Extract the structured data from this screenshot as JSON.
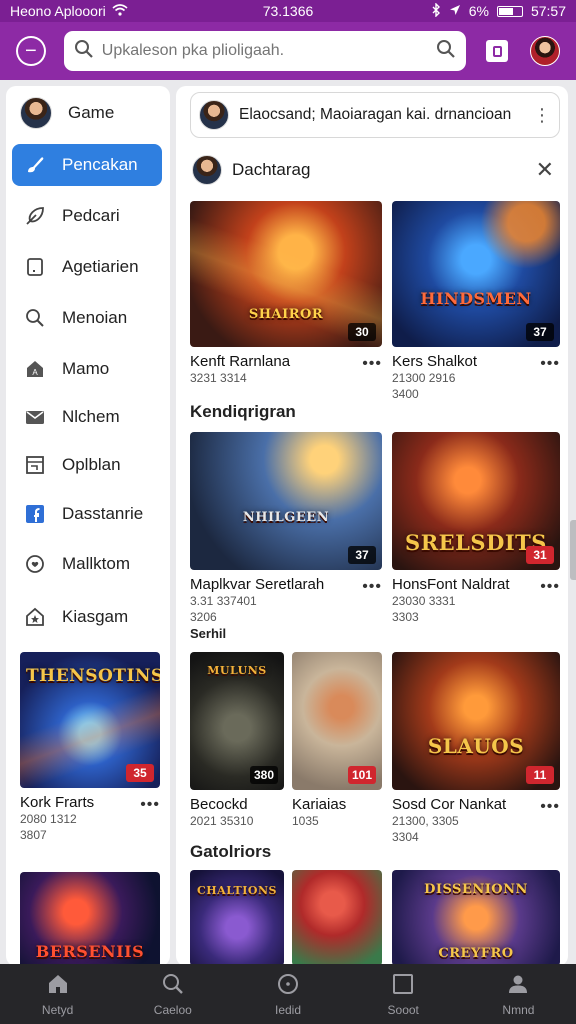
{
  "status": {
    "carrier": "Heono Aplooori",
    "time": "73.1366",
    "battery": "6%",
    "clock": "57:57"
  },
  "topbar": {
    "search_placeholder": "Upkaleson pka plioligaah."
  },
  "sidebar": {
    "items": [
      {
        "label": "Game",
        "icon": "user-avatar-icon"
      },
      {
        "label": "Pencakan",
        "icon": "brush-icon",
        "active": true
      },
      {
        "label": "Pedcari",
        "icon": "feather-icon"
      },
      {
        "label": "Agetiarien",
        "icon": "tablet-icon"
      },
      {
        "label": "Menoian",
        "icon": "search-icon"
      },
      {
        "label": "Mamo",
        "icon": "home-a-icon"
      },
      {
        "label": "Nlchem",
        "icon": "mail-icon"
      },
      {
        "label": "Oplblan",
        "icon": "window-icon"
      },
      {
        "label": "Dasstanrie",
        "icon": "facebook-icon"
      },
      {
        "label": "Mallktom",
        "icon": "heart-icon"
      },
      {
        "label": "Kiasgam",
        "icon": "star-house-icon"
      }
    ],
    "cards": [
      {
        "art_title": "THENSOTINS",
        "badge": "35",
        "title": "Kork Frarts",
        "meta1": "2080  1312",
        "meta2": "3807"
      },
      {
        "art_title": "BERSENIIS"
      }
    ]
  },
  "main": {
    "header": "Elaocsand; Maoiaragan kai. drnancioan",
    "panel_title": "Dachtarag",
    "sections": [
      "Kendiqrigran",
      "Serhil",
      "Gatolriors"
    ],
    "row1": [
      {
        "art_title": "SHAIROR",
        "badge": "30",
        "title": "Kenft Rarnlana",
        "meta1": "3231  3314"
      },
      {
        "art_title": "HINDSMEN",
        "badge": "37",
        "title": "Kers Shalkot",
        "meta1": "21300  2916",
        "meta2": "3400"
      }
    ],
    "row2": [
      {
        "art_title": "NHILGEEN",
        "badge": "37",
        "title": "Maplkvar Seretlarah",
        "meta1": "3.31  337401",
        "meta2": "3206"
      },
      {
        "art_title": "SRELSDITS",
        "badge": "31",
        "title": "HonsFont Naldrat",
        "meta1": "23030  3331",
        "meta2": "3303"
      }
    ],
    "row3": [
      {
        "art_title": "MULUNS",
        "badge": "380",
        "title": "Becockd",
        "meta1": "2021  35310"
      },
      {
        "art_title": "",
        "badge": "101",
        "title": "Kariaias",
        "meta1": "1035"
      },
      {
        "art_title": "SLAUOS",
        "badge": "11",
        "title": "Sosd Cor Nankat",
        "meta1": "21300, 3305",
        "meta2": "3304"
      }
    ],
    "row4": [
      {
        "art_title": "CHALTIONS"
      },
      {
        "art_title": ""
      },
      {
        "art_title": "DISSENIONN",
        "art_sub": "CREYFRO"
      }
    ]
  },
  "bottom_nav": [
    {
      "label": "Netyd",
      "icon": "home-icon"
    },
    {
      "label": "Caeloo",
      "icon": "search-icon"
    },
    {
      "label": "Iedid",
      "icon": "compass-icon"
    },
    {
      "label": "Sooot",
      "icon": "square-icon"
    },
    {
      "label": "Nmnd",
      "icon": "profile-icon"
    }
  ],
  "colors": {
    "topbar": "#8d2aa5",
    "accent": "#2f7fe0",
    "badge_red": "#d0262e"
  }
}
